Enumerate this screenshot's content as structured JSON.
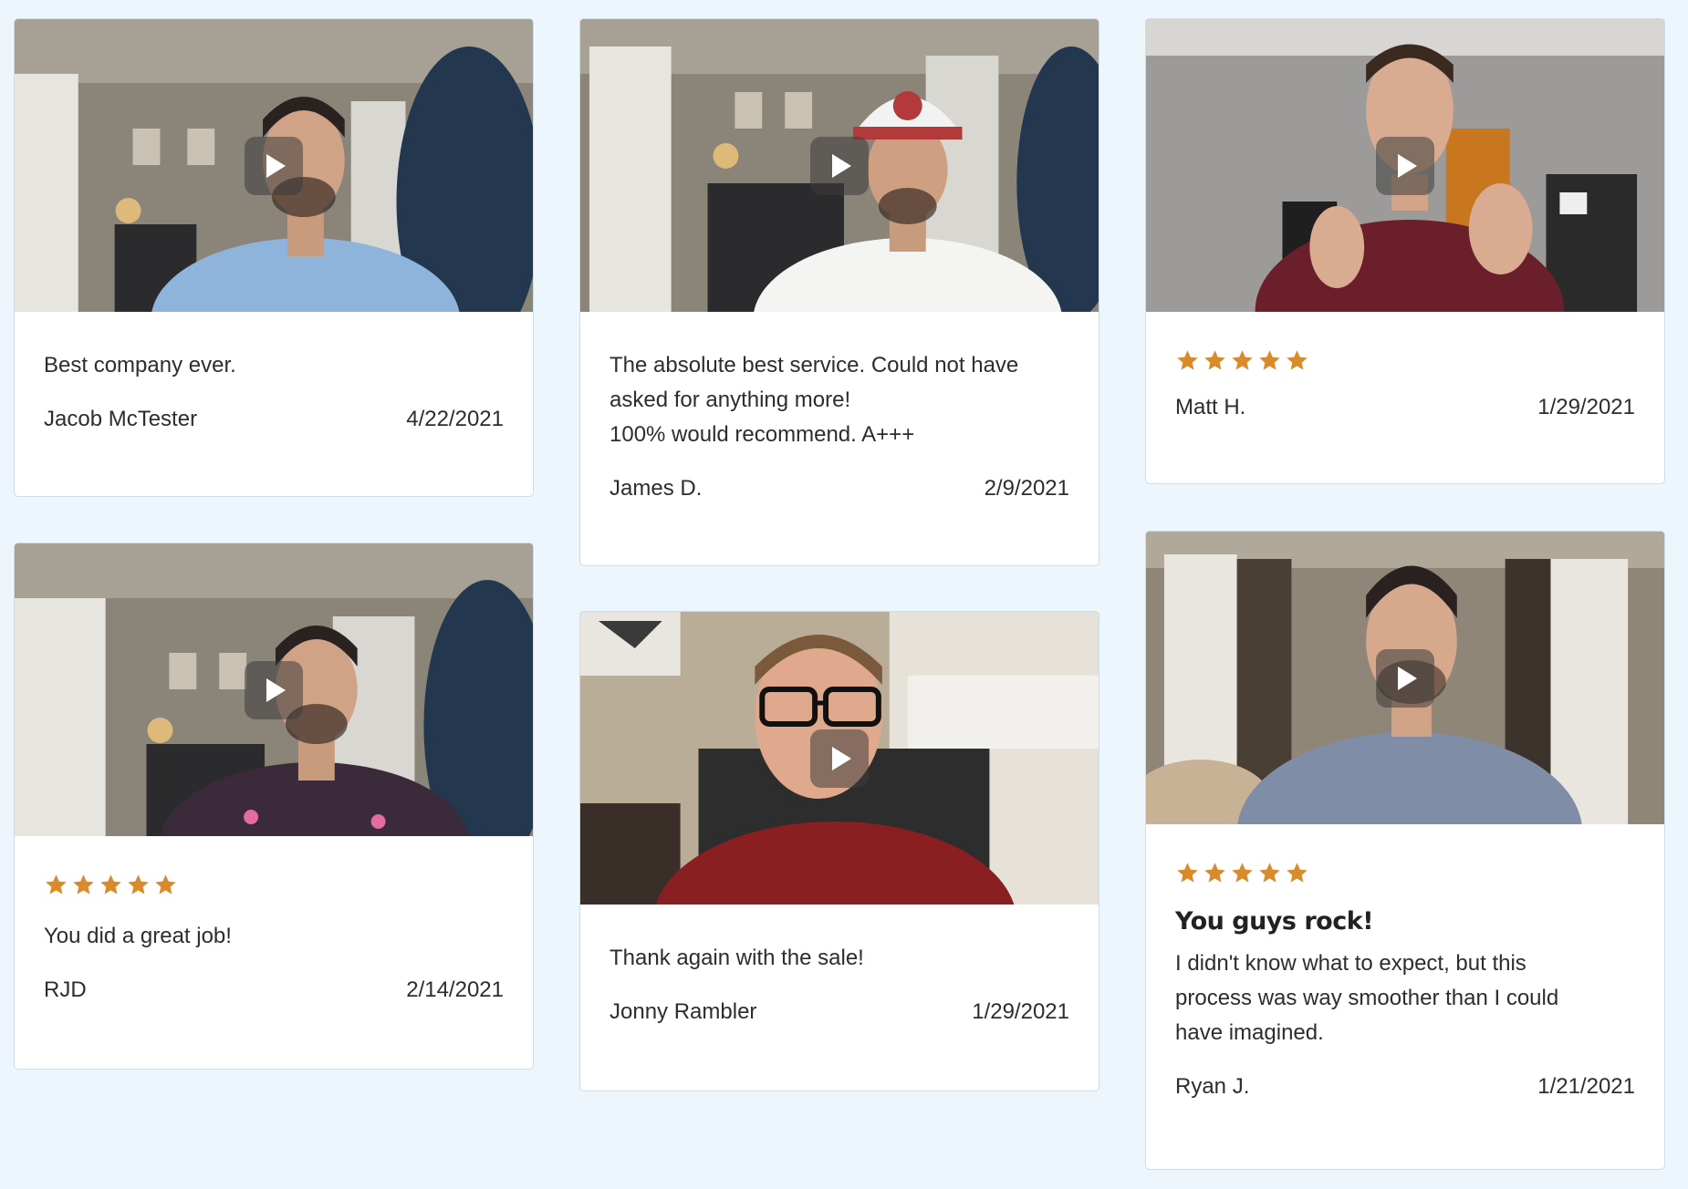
{
  "reviews": [
    {
      "text": [
        "Best company ever."
      ],
      "author": "Jacob McTester",
      "date": "4/22/2021",
      "stars": 0,
      "headline": ""
    },
    {
      "text": [
        "The absolute best service. Could not have",
        "asked for anything more!",
        "100% would recommend. A+++"
      ],
      "author": "James D.",
      "date": "2/9/2021",
      "stars": 0,
      "headline": ""
    },
    {
      "text": [],
      "author": "Matt H.",
      "date": "1/29/2021",
      "stars": 5,
      "headline": ""
    },
    {
      "text": [
        "You did a great job!"
      ],
      "author": "RJD",
      "date": "2/14/2021",
      "stars": 5,
      "headline": ""
    },
    {
      "text": [
        "Thank again with the sale!"
      ],
      "author": "Jonny Rambler",
      "date": "1/29/2021",
      "stars": 0,
      "headline": ""
    },
    {
      "text": [
        "I didn't know what to expect, but this",
        "process was way smoother than I could",
        "have imagined."
      ],
      "author": "Ryan J.",
      "date": "1/21/2021",
      "stars": 5,
      "headline": "You guys rock!"
    }
  ],
  "colors": {
    "star": "#d98a2b",
    "background": "#eef6fd",
    "card_border": "#cfdbe6"
  },
  "icons": {
    "play": "play-icon",
    "star": "star-icon"
  }
}
